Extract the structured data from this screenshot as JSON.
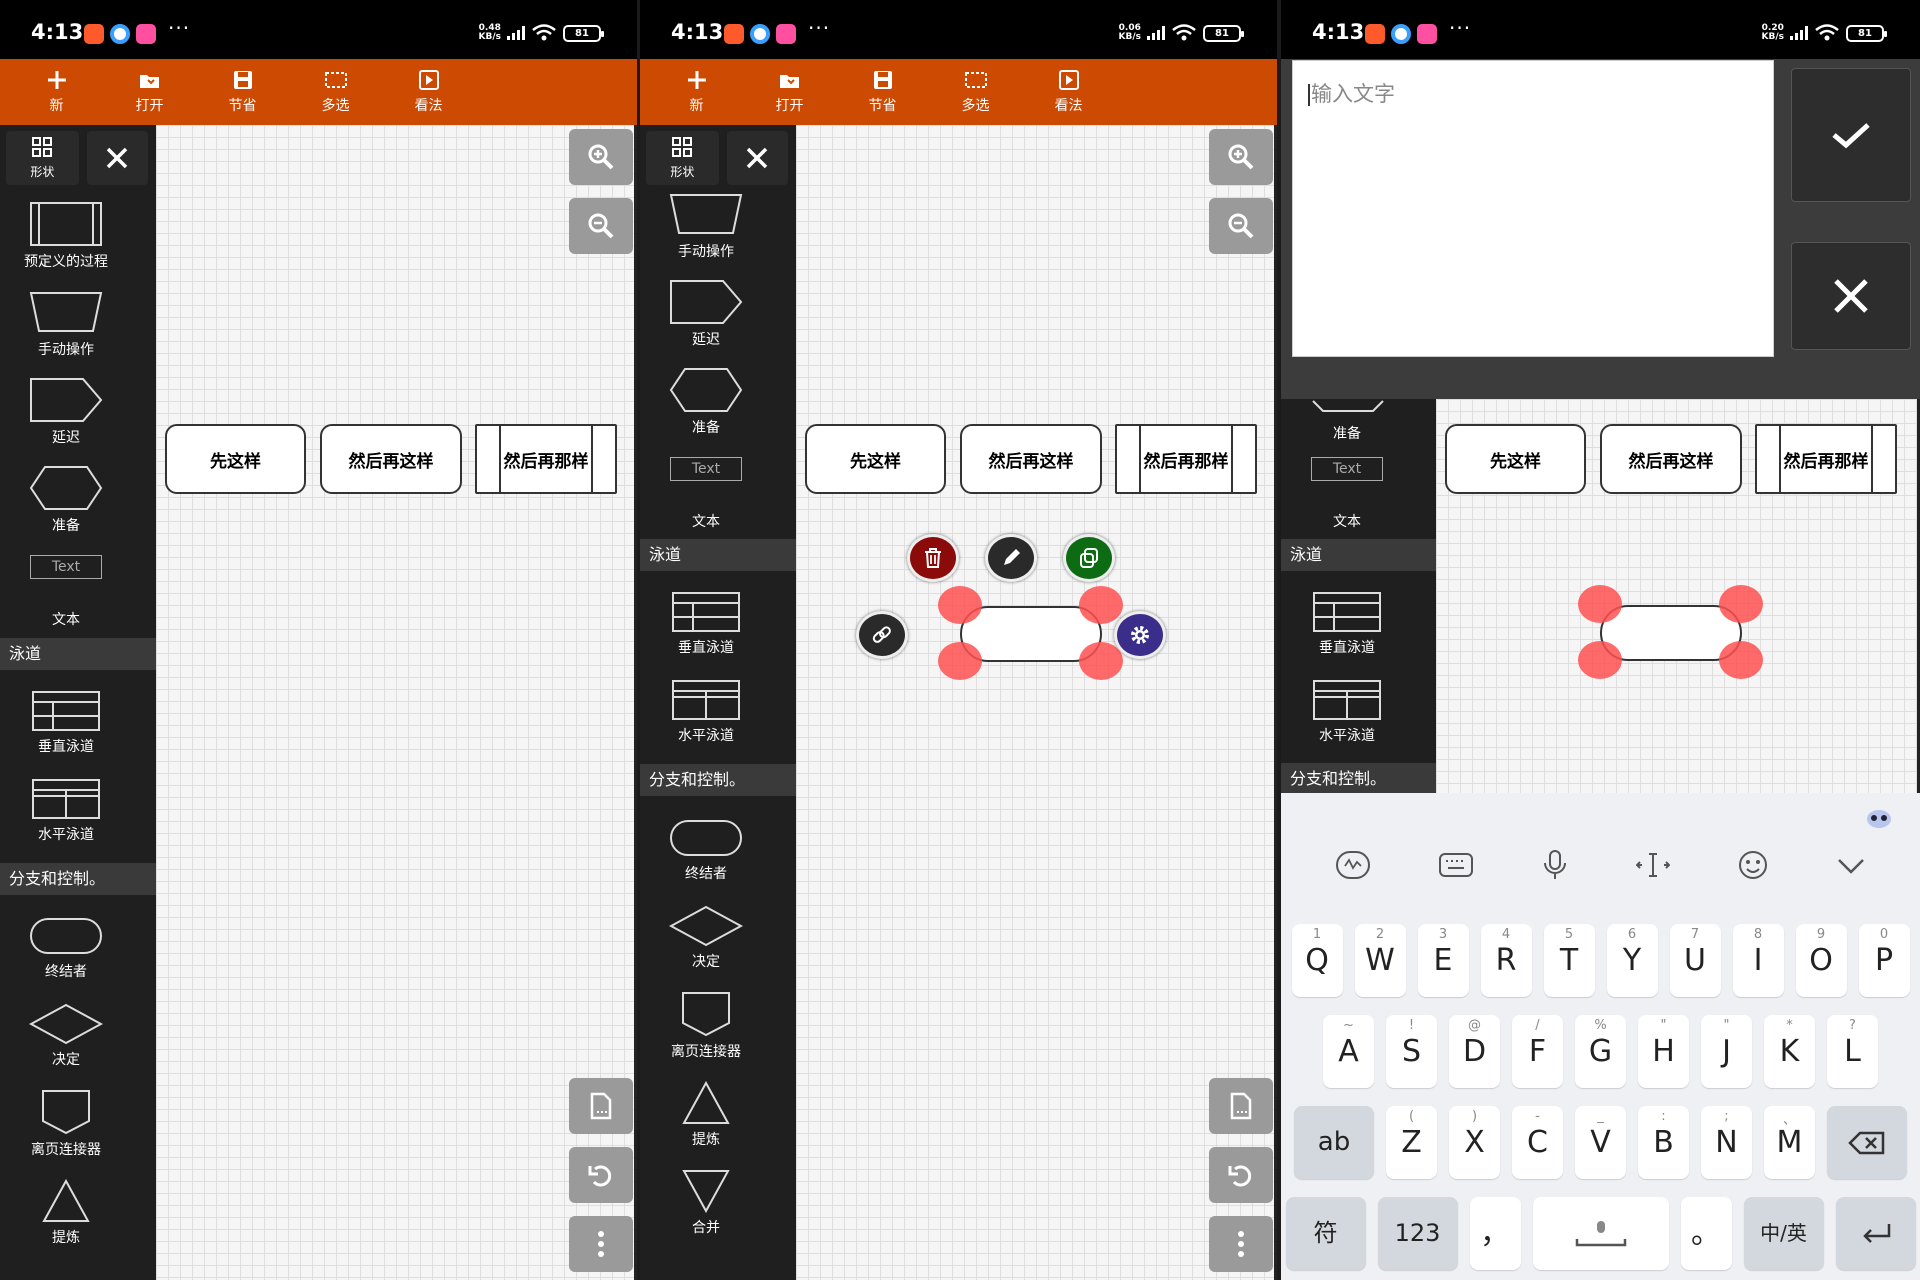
{
  "status_bars": [
    {
      "time": "4:13",
      "speed_value": "0.48",
      "speed_unit": "KB/s",
      "battery": "81"
    },
    {
      "time": "4:13",
      "speed_value": "0.06",
      "speed_unit": "KB/s",
      "battery": "81"
    },
    {
      "time": "4:13",
      "speed_value": "0.20",
      "speed_unit": "KB/s",
      "battery": "81"
    }
  ],
  "status_dots": "···",
  "colors": {
    "toolbar": "#cc4a02",
    "sidebar": "#1f1f1f",
    "handle": "#ff5050",
    "delete": "#8b0a0a",
    "copy": "#0d6b14",
    "settings": "#3b2d8a"
  },
  "toolbar": {
    "new_label": "新",
    "open_label": "打开",
    "save_label": "节省",
    "multiselect_label": "多选",
    "view_label": "看法"
  },
  "sidebar": {
    "shapes_label": "形状",
    "panel1_items": [
      "预定义的过程",
      "手动操作",
      "延迟",
      "准备"
    ],
    "text_shape": "Text",
    "text_label": "文本",
    "section_lanes": "泳道",
    "lanes": [
      "垂直泳道",
      "水平泳道"
    ],
    "section_branch": "分支和控制。",
    "branch_items": [
      "终结者",
      "决定",
      "离页连接器",
      "提炼",
      "合并"
    ]
  },
  "diagram": {
    "nodes": [
      "先这样",
      "然后再这样",
      "然后再那样"
    ]
  },
  "text_editor": {
    "placeholder": "输入文字"
  },
  "keyboard": {
    "row1": [
      [
        "Q",
        "1"
      ],
      [
        "W",
        "2"
      ],
      [
        "E",
        "3"
      ],
      [
        "R",
        "4"
      ],
      [
        "T",
        "5"
      ],
      [
        "Y",
        "6"
      ],
      [
        "U",
        "7"
      ],
      [
        "I",
        "8"
      ],
      [
        "O",
        "9"
      ],
      [
        "P",
        "0"
      ]
    ],
    "row2": [
      [
        "A",
        "~"
      ],
      [
        "S",
        "!"
      ],
      [
        "D",
        "@"
      ],
      [
        "F",
        "/"
      ],
      [
        "G",
        "%"
      ],
      [
        "H",
        "\""
      ],
      [
        "J",
        "\""
      ],
      [
        "K",
        "*"
      ],
      [
        "L",
        "?"
      ]
    ],
    "row3": [
      [
        "Z",
        "("
      ],
      [
        "X",
        ")"
      ],
      [
        "C",
        "-"
      ],
      [
        "V",
        "_"
      ],
      [
        "B",
        ":"
      ],
      [
        "N",
        ";"
      ],
      [
        "M",
        "、"
      ]
    ],
    "ab_label": "ab",
    "sym_label": "符",
    "num_label": "123",
    "comma_label": "，",
    "period_label": "。",
    "lang_label": "中/英"
  }
}
